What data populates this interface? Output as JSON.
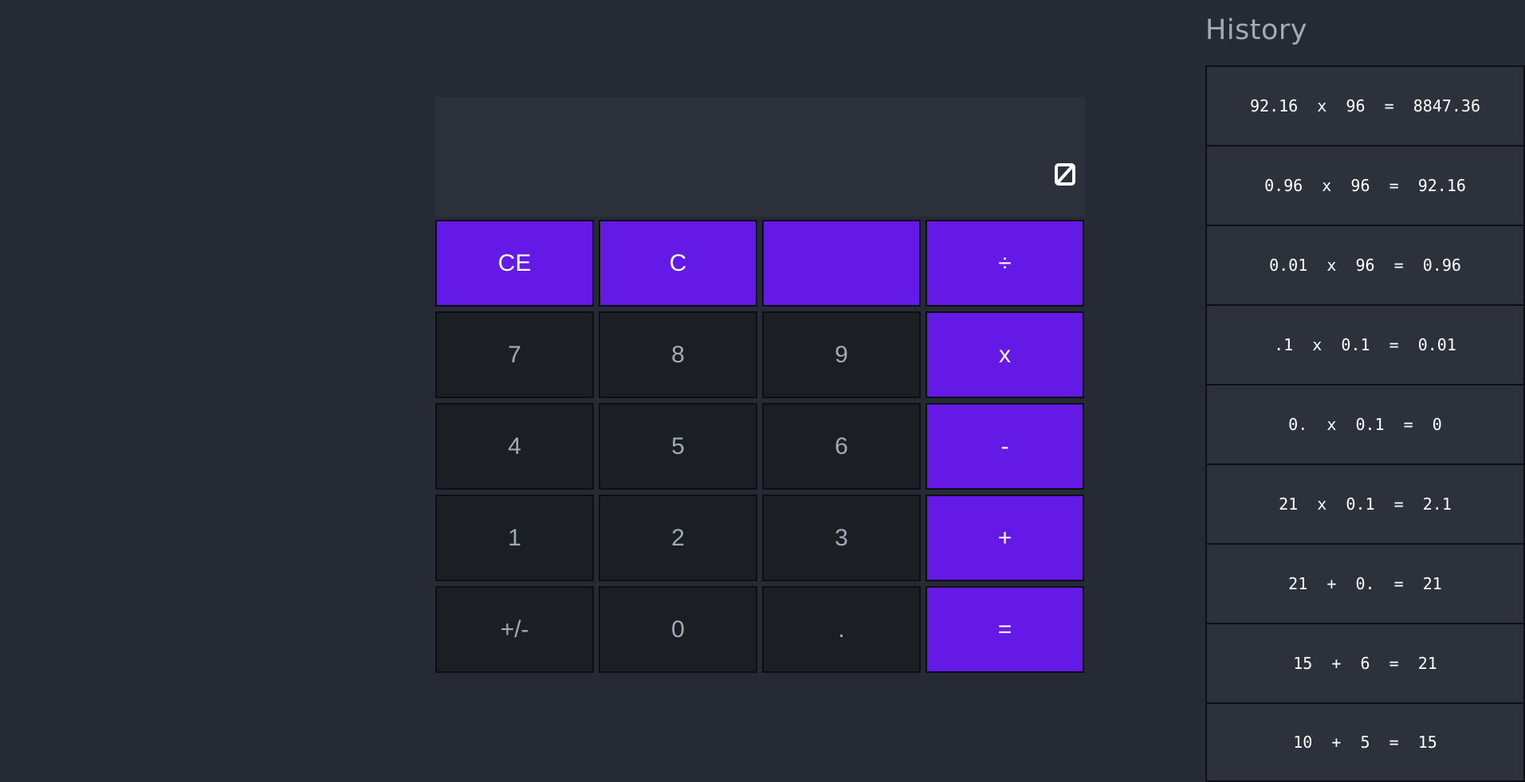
{
  "display": {
    "value": ""
  },
  "keys": [
    {
      "label": "CE",
      "type": "op",
      "name": "clear-entry-button"
    },
    {
      "label": "C",
      "type": "op",
      "name": "clear-button"
    },
    {
      "label": "",
      "type": "op",
      "name": "blank-button"
    },
    {
      "label": "÷",
      "type": "op",
      "name": "divide-button"
    },
    {
      "label": "7",
      "type": "num",
      "name": "digit-7-button"
    },
    {
      "label": "8",
      "type": "num",
      "name": "digit-8-button"
    },
    {
      "label": "9",
      "type": "num",
      "name": "digit-9-button"
    },
    {
      "label": "x",
      "type": "op",
      "name": "multiply-button"
    },
    {
      "label": "4",
      "type": "num",
      "name": "digit-4-button"
    },
    {
      "label": "5",
      "type": "num",
      "name": "digit-5-button"
    },
    {
      "label": "6",
      "type": "num",
      "name": "digit-6-button"
    },
    {
      "label": "-",
      "type": "op",
      "name": "subtract-button"
    },
    {
      "label": "1",
      "type": "num",
      "name": "digit-1-button"
    },
    {
      "label": "2",
      "type": "num",
      "name": "digit-2-button"
    },
    {
      "label": "3",
      "type": "num",
      "name": "digit-3-button"
    },
    {
      "label": "+",
      "type": "op",
      "name": "add-button"
    },
    {
      "label": "+/-",
      "type": "num",
      "name": "negate-button"
    },
    {
      "label": "0",
      "type": "num",
      "name": "digit-0-button"
    },
    {
      "label": ".",
      "type": "num",
      "name": "decimal-button"
    },
    {
      "label": "=",
      "type": "op",
      "name": "equals-button"
    }
  ],
  "history": {
    "title": "History",
    "items": [
      "92.16  x  96  =  8847.36",
      "0.96  x  96  =  92.16",
      "0.01  x  96  =  0.96",
      ".1  x  0.1  =  0.01",
      "0.  x  0.1  =  0",
      "21  x  0.1  =  2.1",
      "21  +  0.  =  21",
      "15  +  6  =  21",
      "10  +  5  =  15"
    ]
  },
  "colors": {
    "accent": "#6419e6",
    "key_dark": "#1b1e24",
    "panel": "#2c313c",
    "background": "#262a34"
  }
}
